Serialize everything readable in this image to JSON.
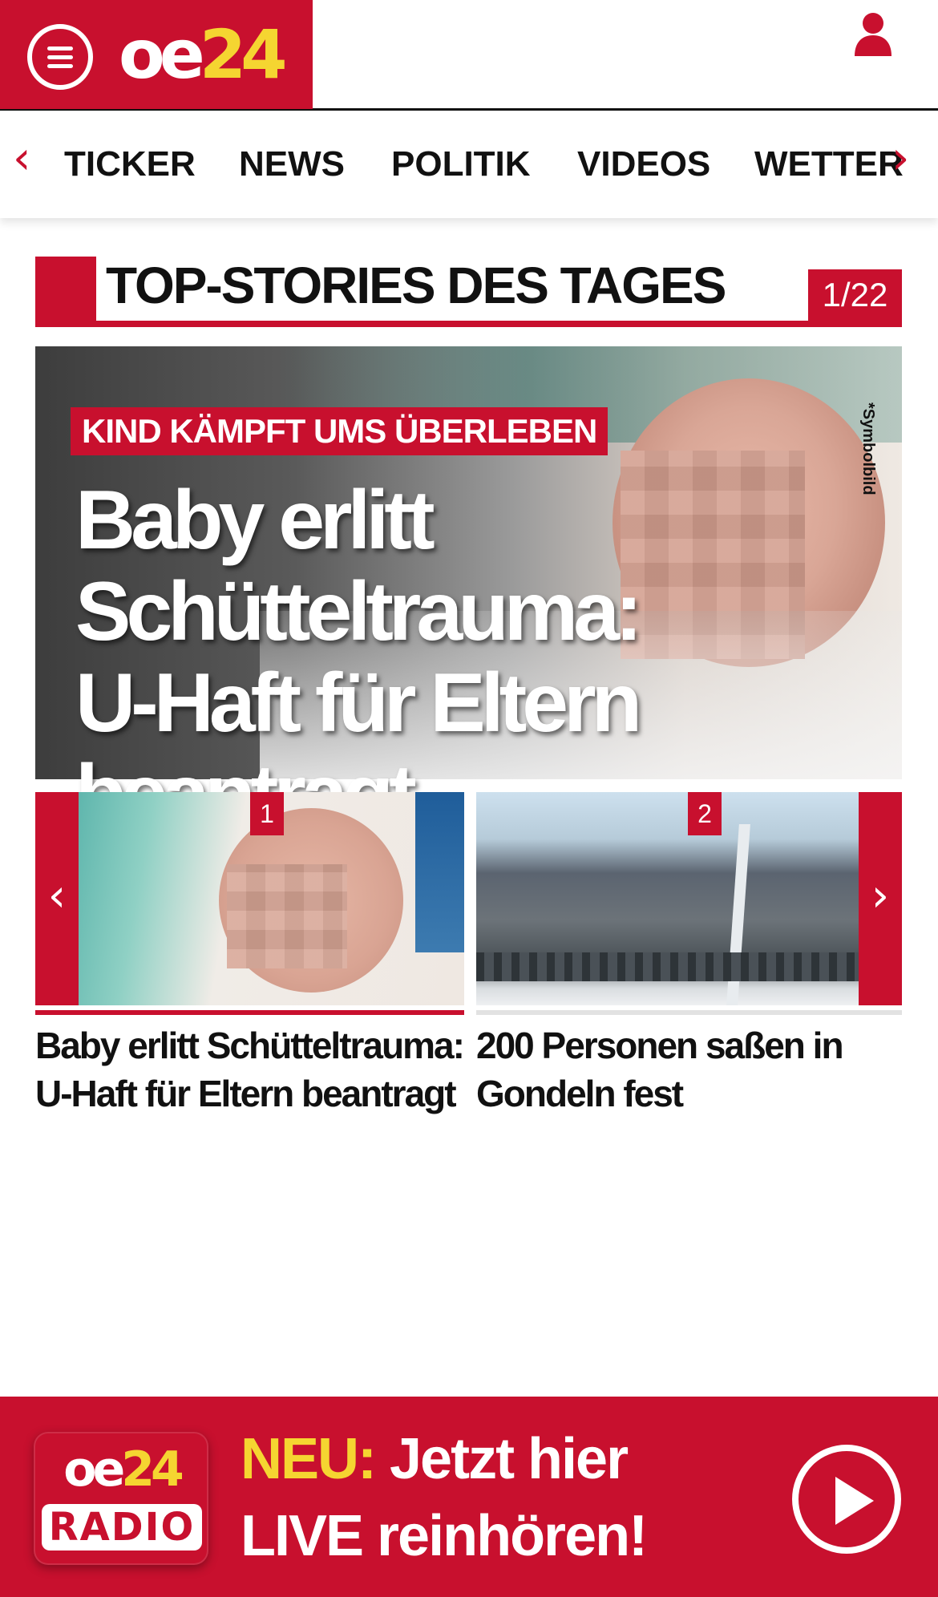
{
  "header": {
    "logo_oe": "oe",
    "logo_num": "24",
    "brand_color": "#c8102e",
    "accent_yellow": "#f5d531",
    "menu_icon": "hamburger-menu-icon",
    "user_icon": "user-icon"
  },
  "nav": {
    "items": [
      {
        "label": "TICKER"
      },
      {
        "label": "NEWS"
      },
      {
        "label": "POLITIK"
      },
      {
        "label": "VIDEOS"
      },
      {
        "label": "WETTER"
      }
    ],
    "prev_arrow": "‹",
    "next_arrow": "›"
  },
  "section": {
    "title": "TOP-STORIES DES TAGES",
    "counter": "1/22"
  },
  "hero": {
    "kicker": "KIND KÄMPFT UMS ÜBERLEBEN",
    "headline_line1": "Baby erlitt",
    "headline_line2": "Schütteltrauma:",
    "headline_line3": "U-Haft für Eltern beantragt",
    "image_note": "*Symbolbild"
  },
  "carousel": {
    "prev_arrow": "‹",
    "next_arrow": "›",
    "stories": [
      {
        "number": "1",
        "title": "Baby erlitt Schütteltrauma: U-Haft für Eltern beantragt"
      },
      {
        "number": "2",
        "title": "200 Personen saßen in Gondeln fest"
      }
    ]
  },
  "radio": {
    "logo_oe": "oe",
    "logo_num": "24",
    "logo_word": "RADIO",
    "neu": "NEU:",
    "line1_rest": " Jetzt hier",
    "line2": "LIVE reinhören!",
    "play_icon": "play-icon"
  }
}
